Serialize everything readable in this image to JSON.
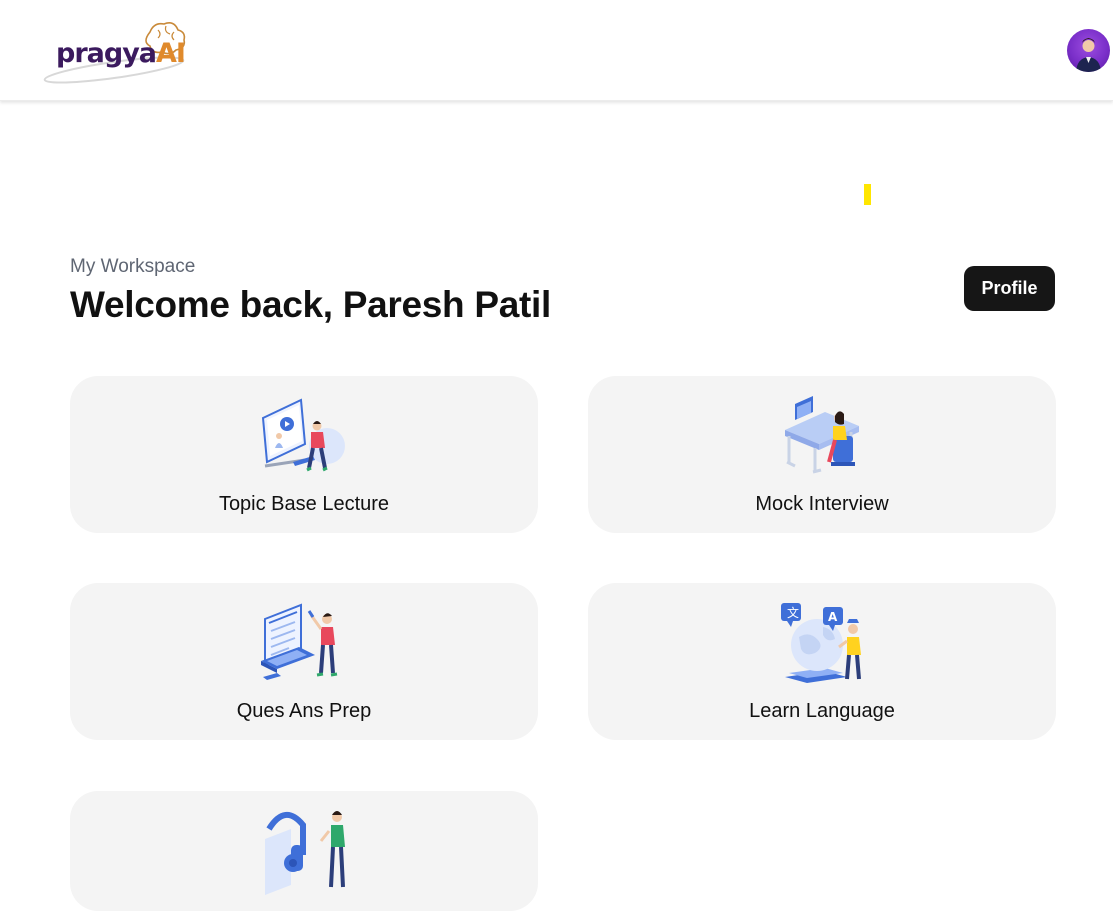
{
  "header": {
    "logo_main": "pragya",
    "logo_accent": "AI"
  },
  "workspace": {
    "label": "My Workspace",
    "welcome": "Welcome back, Paresh Patil",
    "profile_button": "Profile"
  },
  "cards": [
    {
      "label": "Topic Base Lecture",
      "icon": "lecture-illustration"
    },
    {
      "label": "Mock Interview",
      "icon": "interview-illustration"
    },
    {
      "label": "Ques Ans Prep",
      "icon": "qa-prep-illustration"
    },
    {
      "label": "Learn Language",
      "icon": "language-illustration"
    },
    {
      "label": "",
      "icon": "audio-learning-illustration"
    }
  ],
  "colors": {
    "brand_purple": "#3b1a5e",
    "brand_orange": "#e08a2c",
    "button_bg": "#161616",
    "card_bg": "#f4f4f4",
    "illustration_blue": "#3f6fd8",
    "marker_yellow": "#ffe600"
  }
}
